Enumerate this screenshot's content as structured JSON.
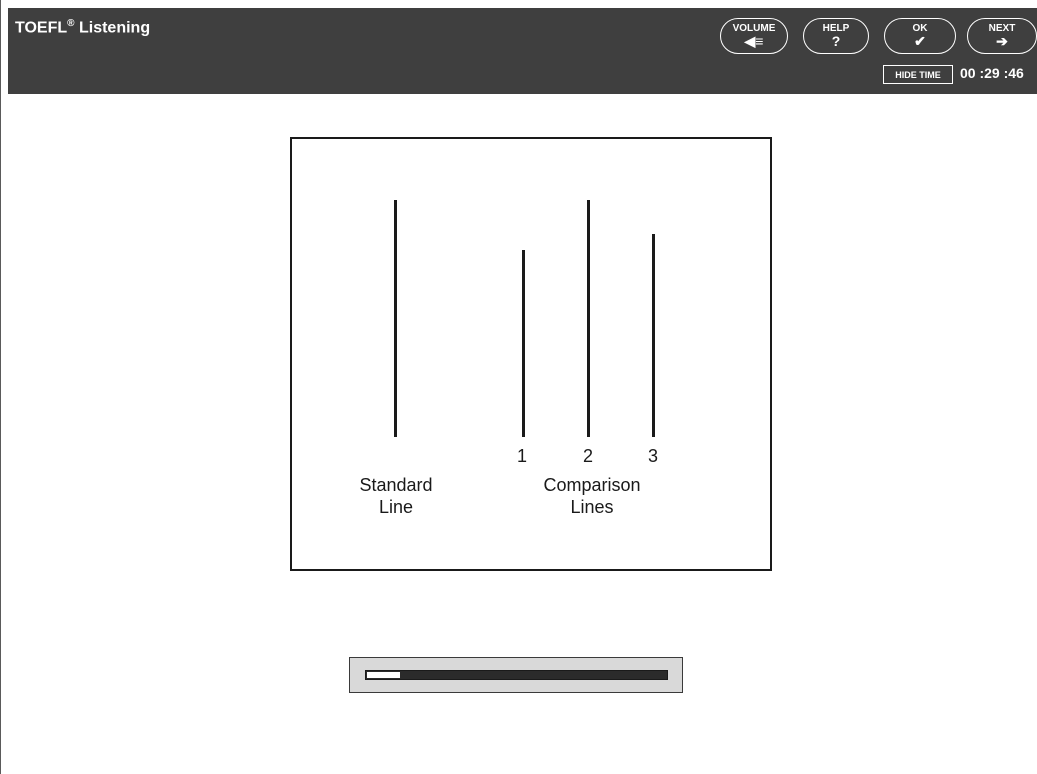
{
  "header": {
    "app_title": "TOEFL",
    "app_title_reg": "®",
    "app_title_suffix": " Listening",
    "buttons": {
      "volume": {
        "label": "VOLUME",
        "glyph": "◀≡"
      },
      "help": {
        "label": "HELP",
        "glyph": "?"
      },
      "ok": {
        "label": "OK",
        "glyph": "✔"
      },
      "next": {
        "label": "NEXT",
        "glyph": "➔"
      }
    },
    "hide_time_label": "HIDE TIME",
    "timer": "00 :29 :46"
  },
  "figure": {
    "standard_caption_line1": "Standard",
    "standard_caption_line2": "Line",
    "comparison_numbers": [
      "1",
      "2",
      "3"
    ],
    "comparison_caption_line1": "Comparison",
    "comparison_caption_line2": "Lines"
  },
  "progress": {
    "fraction": 0.11
  },
  "colors": {
    "header_bg": "#3f3f3f",
    "ink": "#1a1a1a",
    "progress_bg": "#d9d9d9"
  }
}
